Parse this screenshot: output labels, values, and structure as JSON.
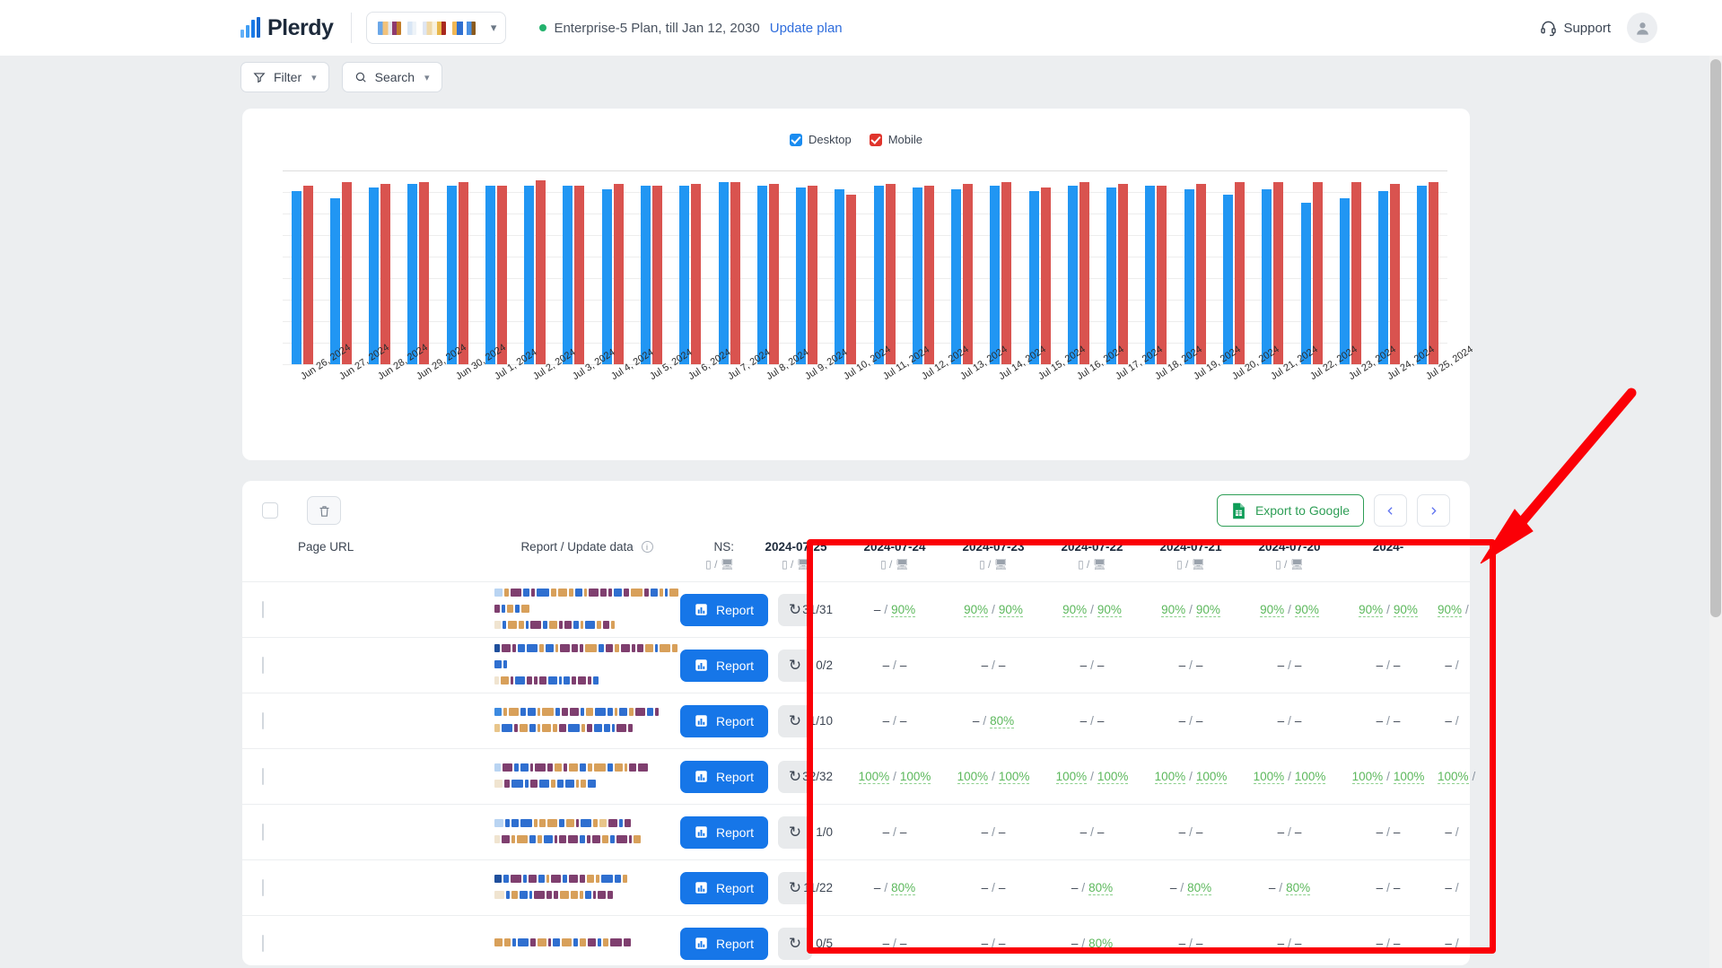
{
  "header": {
    "brand": "Plerdy",
    "site_selector_icon": "site-thumbnails",
    "chevron_icon": "chevron-down-icon",
    "plan_text": "Enterprise-5 Plan, till Jan 12, 2030",
    "update_plan_label": "Update plan",
    "support_label": "Support",
    "support_icon": "headset-icon",
    "avatar_icon": "user-avatar-icon"
  },
  "toolbar": {
    "filter_label": "Filter",
    "filter_icon": "funnel-icon",
    "search_label": "Search",
    "search_icon": "search-icon",
    "chevron": "⌄"
  },
  "chart_data": {
    "type": "bar",
    "title": "",
    "xlabel": "",
    "ylabel": "",
    "grid": true,
    "legend_position": "top-center",
    "legend": [
      {
        "name": "Desktop",
        "color": "#2196f3",
        "checked": true
      },
      {
        "name": "Mobile",
        "color": "#d9534f",
        "checked": true
      }
    ],
    "categories": [
      "Jun 26, 2024",
      "Jun 27, 2024",
      "Jun 28, 2024",
      "Jun 29, 2024",
      "Jun 30, 2024",
      "Jul 1, 2024",
      "Jul 2, 2024",
      "Jul 3, 2024",
      "Jul 4, 2024",
      "Jul 5, 2024",
      "Jul 6, 2024",
      "Jul 7, 2024",
      "Jul 8, 2024",
      "Jul 9, 2024",
      "Jul 10, 2024",
      "Jul 11, 2024",
      "Jul 12, 2024",
      "Jul 13, 2024",
      "Jul 14, 2024",
      "Jul 15, 2024",
      "Jul 16, 2024",
      "Jul 17, 2024",
      "Jul 18, 2024",
      "Jul 19, 2024",
      "Jul 20, 2024",
      "Jul 21, 2024",
      "Jul 22, 2024",
      "Jul 23, 2024",
      "Jul 24, 2024",
      "Jul 25, 2024"
    ],
    "ylim": [
      0,
      100
    ],
    "series": [
      {
        "name": "Desktop",
        "color": "#2196f3",
        "values": [
          92,
          88,
          94,
          96,
          95,
          95,
          95,
          95,
          93,
          95,
          95,
          97,
          95,
          94,
          93,
          95,
          94,
          93,
          95,
          92,
          95,
          94,
          95,
          93,
          90,
          93,
          86,
          88,
          92,
          95
        ]
      },
      {
        "name": "Mobile",
        "color": "#d9534f",
        "values": [
          95,
          97,
          96,
          97,
          97,
          95,
          98,
          95,
          96,
          95,
          96,
          97,
          96,
          95,
          90,
          96,
          95,
          96,
          97,
          94,
          97,
          96,
          95,
          96,
          97,
          97,
          97,
          97,
          96,
          97
        ]
      }
    ]
  },
  "table": {
    "select_all_checkbox": "unchecked",
    "delete_icon": "trash-icon",
    "export_label": "Export to Google",
    "export_icon": "google-sheets-icon",
    "prev_icon": "chevron-left-icon",
    "next_icon": "chevron-right-icon",
    "columns": {
      "page_url": "Page URL",
      "report": "Report / Update data",
      "report_info_icon": "info-icon",
      "ns": "NS:",
      "device_sub": "▯ / 🖥"
    },
    "date_columns": [
      "2024-07-25",
      "2024-07-24",
      "2024-07-23",
      "2024-07-22",
      "2024-07-21",
      "2024-07-20",
      "2024-"
    ],
    "report_button_label": "Report",
    "report_button_icon": "bar-chart-icon",
    "refresh_button_icon": "refresh-icon",
    "rows": [
      {
        "ns": "31/31",
        "values": [
          [
            "–",
            "90%"
          ],
          [
            "90%",
            "90%"
          ],
          [
            "90%",
            "90%"
          ],
          [
            "90%",
            "90%"
          ],
          [
            "90%",
            "90%"
          ],
          [
            "90%",
            "90%"
          ],
          [
            "90%",
            ""
          ]
        ]
      },
      {
        "ns": "0/2",
        "values": [
          [
            "–",
            "–"
          ],
          [
            "–",
            "–"
          ],
          [
            "–",
            "–"
          ],
          [
            "–",
            "–"
          ],
          [
            "–",
            "–"
          ],
          [
            "–",
            "–"
          ],
          [
            "–",
            ""
          ]
        ]
      },
      {
        "ns": "1/10",
        "values": [
          [
            "–",
            "–"
          ],
          [
            "–",
            "80%"
          ],
          [
            "–",
            "–"
          ],
          [
            "–",
            "–"
          ],
          [
            "–",
            "–"
          ],
          [
            "–",
            "–"
          ],
          [
            "–",
            ""
          ]
        ]
      },
      {
        "ns": "32/32",
        "values": [
          [
            "100%",
            "100%"
          ],
          [
            "100%",
            "100%"
          ],
          [
            "100%",
            "100%"
          ],
          [
            "100%",
            "100%"
          ],
          [
            "100%",
            "100%"
          ],
          [
            "100%",
            "100%"
          ],
          [
            "100%",
            ""
          ]
        ]
      },
      {
        "ns": "1/0",
        "values": [
          [
            "–",
            "–"
          ],
          [
            "–",
            "–"
          ],
          [
            "–",
            "–"
          ],
          [
            "–",
            "–"
          ],
          [
            "–",
            "–"
          ],
          [
            "–",
            "–"
          ],
          [
            "–",
            ""
          ]
        ]
      },
      {
        "ns": "11/22",
        "values": [
          [
            "–",
            "80%"
          ],
          [
            "–",
            "–"
          ],
          [
            "–",
            "80%"
          ],
          [
            "–",
            "80%"
          ],
          [
            "–",
            "80%"
          ],
          [
            "–",
            "–"
          ],
          [
            "–",
            ""
          ]
        ]
      },
      {
        "ns": "0/5",
        "values": [
          [
            "–",
            "–"
          ],
          [
            "–",
            "–"
          ],
          [
            "–",
            "80%"
          ],
          [
            "–",
            "–"
          ],
          [
            "–",
            "–"
          ],
          [
            "–",
            "–"
          ],
          [
            "–",
            ""
          ]
        ]
      }
    ]
  },
  "annotations": {
    "highlight_box_color": "#fb0007",
    "arrow_color": "#fb0007"
  }
}
